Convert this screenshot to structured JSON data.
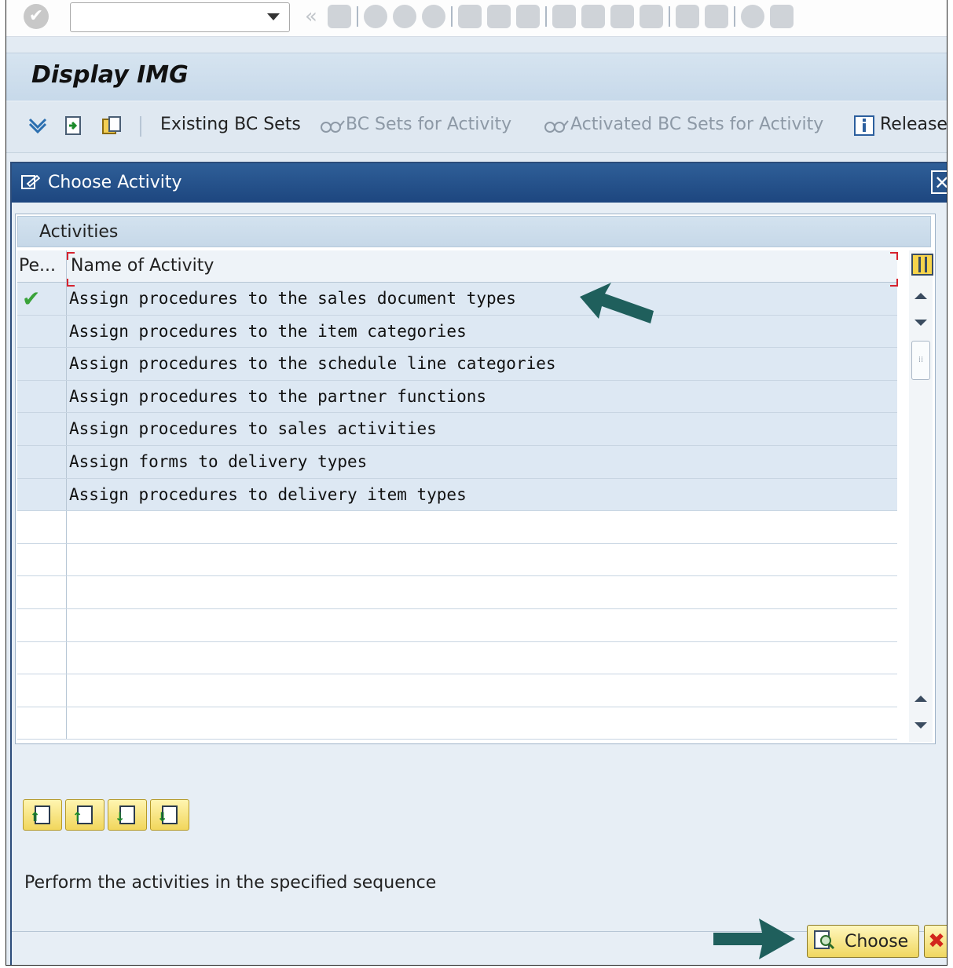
{
  "system_toolbar": {
    "command_field_value": "",
    "icons": [
      "back-icon",
      "save-icon",
      "back-nav-icon",
      "exit-icon",
      "cancel-icon",
      "print-icon",
      "find-icon",
      "find-next-icon",
      "first-page-icon",
      "previous-page-icon",
      "next-page-icon",
      "last-page-icon",
      "create-session-icon",
      "shortcut-icon",
      "help-icon",
      "customize-layout-icon"
    ]
  },
  "title": "Display IMG",
  "app_toolbar": {
    "existing_bc_sets": "Existing BC Sets",
    "bc_sets_for_activity": "BC Sets for Activity",
    "activated_bc_sets": "Activated BC Sets for Activity",
    "release": "Release"
  },
  "dialog": {
    "title": "Choose Activity",
    "table_title": "Activities",
    "columns": [
      "Pe...",
      "Name of Activity"
    ],
    "rows": [
      {
        "done": true,
        "name": "Assign procedures to the sales document types"
      },
      {
        "done": false,
        "name": "Assign procedures to the item categories"
      },
      {
        "done": false,
        "name": "Assign procedures to the schedule line categories"
      },
      {
        "done": false,
        "name": "Assign procedures to the partner functions"
      },
      {
        "done": false,
        "name": "Assign procedures to sales activities"
      },
      {
        "done": false,
        "name": "Assign forms to delivery types"
      },
      {
        "done": false,
        "name": "Assign procedures to delivery item types"
      }
    ],
    "empty_rows": 7,
    "hint": "Perform the activities in the specified sequence",
    "choose_label": "Choose",
    "cancel_icon": "cancel-x-icon"
  },
  "colors": {
    "accent_dark": "#1d467f",
    "callout_arrow": "#1f5f5c",
    "check_green": "#3aa33a"
  }
}
